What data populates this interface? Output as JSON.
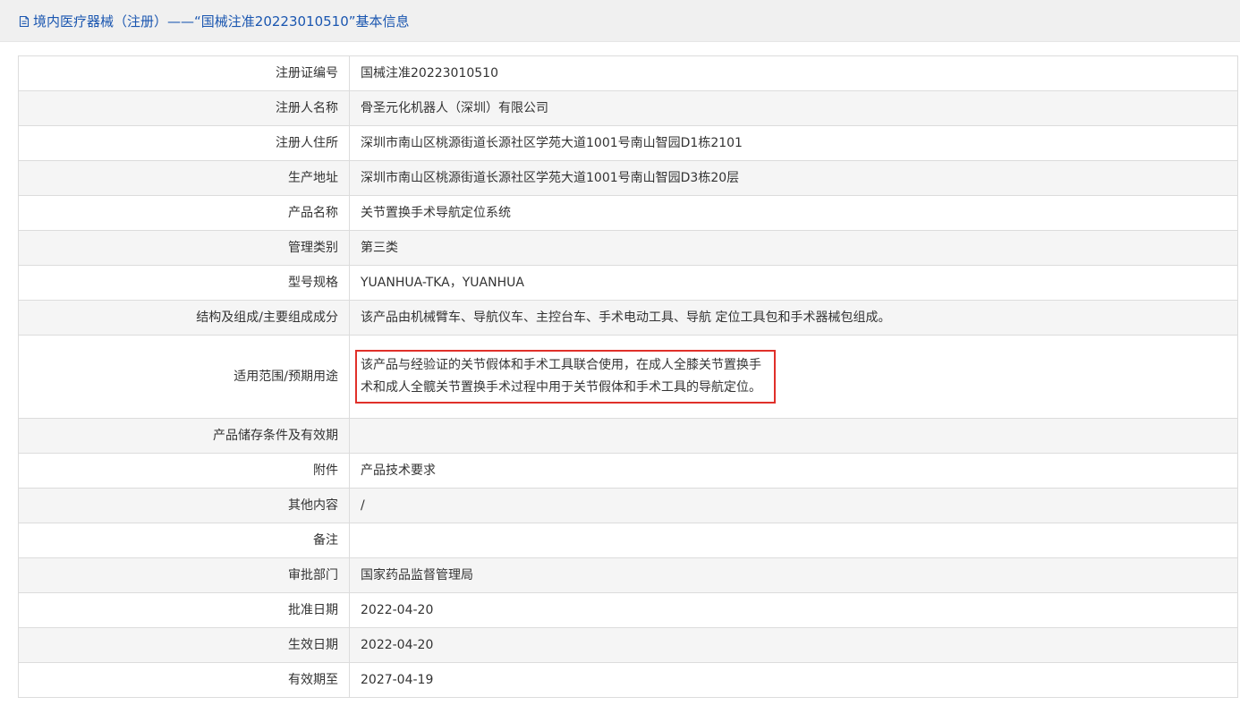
{
  "header": {
    "title": "境内医疗器械（注册）——“国械注准20223010510”基本信息"
  },
  "rows": [
    {
      "label": "注册证编号",
      "value": "国械注准20223010510"
    },
    {
      "label": "注册人名称",
      "value": "骨圣元化机器人（深圳）有限公司"
    },
    {
      "label": "注册人住所",
      "value": "深圳市南山区桃源街道长源社区学苑大道1001号南山智园D1栋2101"
    },
    {
      "label": "生产地址",
      "value": "深圳市南山区桃源街道长源社区学苑大道1001号南山智园D3栋20层"
    },
    {
      "label": "产品名称",
      "value": "关节置换手术导航定位系统"
    },
    {
      "label": "管理类别",
      "value": "第三类"
    },
    {
      "label": "型号规格",
      "value": "YUANHUA-TKA，YUANHUA"
    },
    {
      "label": "结构及组成/主要组成成分",
      "value": "该产品由机械臂车、导航仪车、主控台车、手术电动工具、导航 定位工具包和手术器械包组成。"
    },
    {
      "label": "适用范围/预期用途",
      "value": "该产品与经验证的关节假体和手术工具联合使用，在成人全膝关节置换手术和成人全髋关节置换手术过程中用于关节假体和手术工具的导航定位。"
    },
    {
      "label": "产品储存条件及有效期",
      "value": ""
    },
    {
      "label": "附件",
      "value": "产品技术要求"
    },
    {
      "label": "其他内容",
      "value": "/"
    },
    {
      "label": "备注",
      "value": ""
    },
    {
      "label": "审批部门",
      "value": "国家药品监督管理局"
    },
    {
      "label": "批准日期",
      "value": "2022-04-20"
    },
    {
      "label": "生效日期",
      "value": "2022-04-20"
    },
    {
      "label": "有效期至",
      "value": "2027-04-19"
    }
  ],
  "colors": {
    "title_text": "#1a56b0",
    "title_bg": "#f0f0f0",
    "alt_row_bg": "#f5f5f5",
    "border": "#dcdcdc",
    "highlight": "#e0302a"
  },
  "icons": {
    "title_icon": "document-icon"
  }
}
